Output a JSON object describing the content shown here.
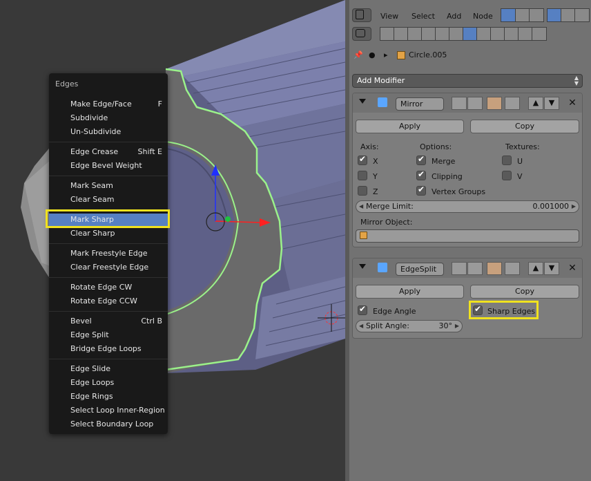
{
  "edges_menu": {
    "title": "Edges",
    "items": [
      {
        "label": "Make Edge/Face",
        "shortcut": "F"
      },
      {
        "label": "Subdivide",
        "shortcut": ""
      },
      {
        "label": "Un-Subdivide",
        "shortcut": ""
      },
      {
        "label": "Edge Crease",
        "shortcut": "Shift E"
      },
      {
        "label": "Edge Bevel Weight",
        "shortcut": ""
      },
      {
        "label": "Mark Seam",
        "shortcut": ""
      },
      {
        "label": "Clear Seam",
        "shortcut": ""
      },
      {
        "label": "Mark Sharp",
        "shortcut": "",
        "active": true
      },
      {
        "label": "Clear Sharp",
        "shortcut": ""
      },
      {
        "label": "Mark Freestyle Edge",
        "shortcut": ""
      },
      {
        "label": "Clear Freestyle Edge",
        "shortcut": ""
      },
      {
        "label": "Rotate Edge CW",
        "shortcut": ""
      },
      {
        "label": "Rotate Edge CCW",
        "shortcut": ""
      },
      {
        "label": "Bevel",
        "shortcut": "Ctrl B"
      },
      {
        "label": "Edge Split",
        "shortcut": ""
      },
      {
        "label": "Bridge Edge Loops",
        "shortcut": ""
      },
      {
        "label": "Edge Slide",
        "shortcut": ""
      },
      {
        "label": "Edge Loops",
        "shortcut": ""
      },
      {
        "label": "Edge Rings",
        "shortcut": ""
      },
      {
        "label": "Select Loop Inner-Region",
        "shortcut": ""
      },
      {
        "label": "Select Boundary Loop",
        "shortcut": ""
      }
    ]
  },
  "header": {
    "menus": [
      "View",
      "Select",
      "Add",
      "Node"
    ]
  },
  "breadcrumb": {
    "object": "Circle.005"
  },
  "add_modifier": {
    "label": "Add Modifier"
  },
  "mirror_modifier": {
    "name": "Mirror",
    "apply_label": "Apply",
    "copy_label": "Copy",
    "axis_header": "Axis:",
    "options_header": "Options:",
    "textures_header": "Textures:",
    "axis": [
      {
        "label": "X",
        "checked": true
      },
      {
        "label": "Y",
        "checked": false
      },
      {
        "label": "Z",
        "checked": false
      }
    ],
    "options": [
      {
        "label": "Merge",
        "checked": true
      },
      {
        "label": "Clipping",
        "checked": true
      },
      {
        "label": "Vertex Groups",
        "checked": true
      }
    ],
    "textures": [
      {
        "label": "U",
        "checked": false
      },
      {
        "label": "V",
        "checked": false
      }
    ],
    "merge_limit_label": "Merge Limit:",
    "merge_limit_value": "0.001000",
    "mirror_object_label": "Mirror Object:"
  },
  "edgesplit_modifier": {
    "name": "EdgeSplit",
    "apply_label": "Apply",
    "copy_label": "Copy",
    "edge_angle_label": "Edge Angle",
    "edge_angle_checked": true,
    "sharp_edges_label": "Sharp Edges",
    "sharp_edges_checked": true,
    "split_angle_label": "Split Angle:",
    "split_angle_value": "30°"
  },
  "colors": {
    "menu_bg": "#191919",
    "menu_active": "#5680c2",
    "highlight": "#f0e21e",
    "panel_bg": "#727272",
    "mesh_face": "#7b7ea6",
    "mesh_cap": "#6a6a6a",
    "selection_edge": "#9bf28a"
  }
}
